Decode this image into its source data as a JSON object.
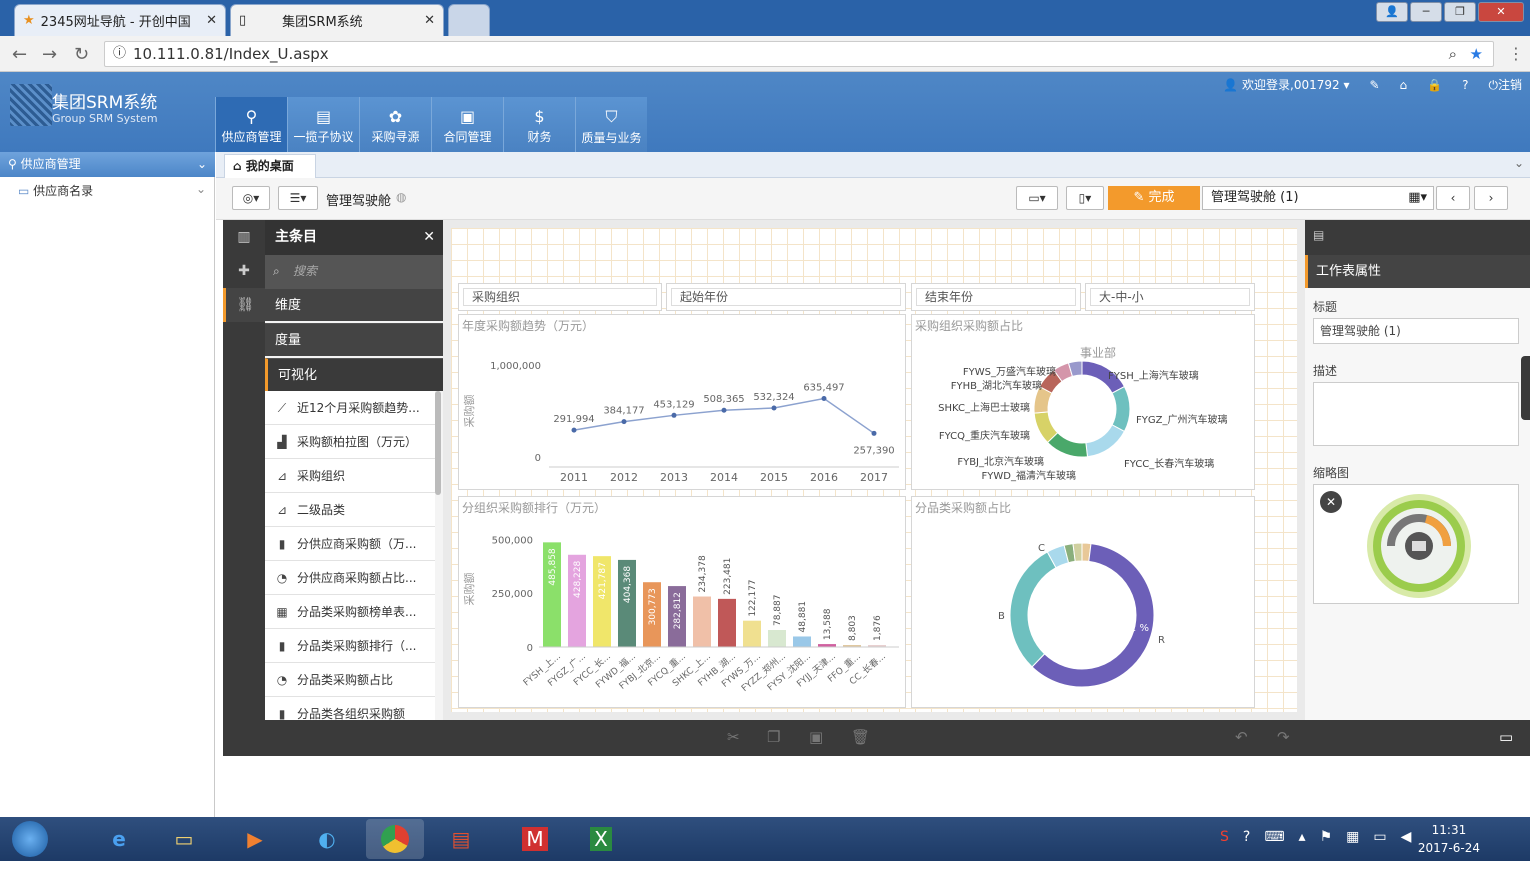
{
  "browser": {
    "tabs": [
      {
        "label": "2345网址导航 - 开创中国"
      },
      {
        "label": "集团SRM系统"
      }
    ],
    "url": "10.111.0.81/Index_U.aspx"
  },
  "app": {
    "title": "集团SRM系统",
    "subtitle": "Group SRM System",
    "modules": [
      {
        "label": "供应商管理"
      },
      {
        "label": "一揽子协议"
      },
      {
        "label": "采购寻源"
      },
      {
        "label": "合同管理"
      },
      {
        "label": "财务"
      },
      {
        "label": "质量与业务"
      }
    ],
    "user": {
      "welcome": "欢迎登录,001792",
      "logout": "注销"
    }
  },
  "sidebar": {
    "header": "供应商管理",
    "items": [
      {
        "label": "供应商名录"
      }
    ]
  },
  "content_tab": {
    "label": "我的桌面"
  },
  "toolbar": {
    "app_name": "管理驾驶舱",
    "done_label": "完成",
    "sheet_name": "管理驾驶舱 (1)"
  },
  "assets": {
    "title": "主条目",
    "search_placeholder": "搜索",
    "categories": [
      {
        "label": "维度"
      },
      {
        "label": "度量"
      },
      {
        "label": "可视化"
      }
    ],
    "items": [
      {
        "label": "近12个月采购额趋势..."
      },
      {
        "label": "采购额柏拉图（万元）"
      },
      {
        "label": "采购组织"
      },
      {
        "label": "二级品类"
      },
      {
        "label": "分供应商采购额（万..."
      },
      {
        "label": "分供应商采购额占比..."
      },
      {
        "label": "分品类采购额榜单表..."
      },
      {
        "label": "分品类采购额排行（..."
      },
      {
        "label": "分品类采购额占比"
      },
      {
        "label": "分品类各组织采购额"
      }
    ]
  },
  "filters": [
    {
      "label": "采购组织"
    },
    {
      "label": "起始年份"
    },
    {
      "label": "结束年份"
    },
    {
      "label": "大-中-小"
    }
  ],
  "chart_data": [
    {
      "type": "line",
      "title": "年度采购额趋势（万元）",
      "ylabel": "采购额",
      "x": [
        "2011",
        "2012",
        "2013",
        "2014",
        "2015",
        "2016",
        "2017"
      ],
      "values": [
        291994,
        384177,
        453129,
        508365,
        532324,
        635497,
        257390
      ],
      "labels": [
        "291,994",
        "384,177",
        "453,129",
        "508,365",
        "532,324",
        "635,497",
        "257,390"
      ],
      "yticks": [
        "1,000,000",
        "0"
      ],
      "ylim": [
        0,
        1000000
      ]
    },
    {
      "type": "pie",
      "title": "采购组织采购额占比",
      "legend_title": "事业部",
      "categories": [
        "FYSH_上海汽车玻璃",
        "FYGZ_广州汽车玻璃",
        "FYCC_长春汽车玻璃",
        "FYWD_福清汽车玻璃",
        "FYBJ_北京汽车玻璃",
        "FYCQ_重庆汽车玻璃",
        "SHKC_上海巴士玻璃",
        "FYHB_湖北汽车玻璃",
        "FYWS_万盛汽车玻璃"
      ],
      "values": [
        19,
        17,
        17,
        16,
        12,
        10,
        8,
        6,
        5
      ]
    },
    {
      "type": "bar",
      "title": "分组织采购额排行（万元）",
      "ylabel": "采购额",
      "categories": [
        "FYSH_上...",
        "FYGZ_广...",
        "FYCC_长...",
        "FYWD_福...",
        "FYBJ_北京...",
        "FYCQ_重...",
        "SHKC_上...",
        "FYHB_湖...",
        "FYWS_万...",
        "FYZZ_郑州...",
        "FYSY_沈阳...",
        "FYJJ_天津...",
        "FFO_重...",
        "CC_长春..."
      ],
      "values": [
        485858,
        428228,
        421787,
        404368,
        300773,
        282812,
        234378,
        223481,
        122177,
        78887,
        48881,
        13588,
        8803,
        1876
      ],
      "labels": [
        "485,858",
        "428,228",
        "421,787",
        "404,368",
        "300,773",
        "282,812",
        "234,378",
        "223,481",
        "122,177",
        "78,887",
        "48,881",
        "13,588",
        "8,803",
        "1,876"
      ],
      "yticks": [
        "500,000",
        "250,000",
        "0"
      ],
      "ylim": [
        0,
        520000
      ]
    },
    {
      "type": "pie",
      "title": "分品类采购额占比",
      "categories": [
        "R",
        "B",
        "C"
      ],
      "values": [
        60.2,
        29.8,
        10.0
      ],
      "labels": [
        "60.2 %",
        "29.8 %"
      ]
    }
  ],
  "properties": {
    "header": "工作表属性",
    "title_label": "标题",
    "title_value": "管理驾驶舱 (1)",
    "desc_label": "描述",
    "thumb_label": "缩略图"
  },
  "taskbar": {
    "time": "11:31",
    "date": "2017-6-24"
  },
  "colors": {
    "app_blue": "#4a82c2",
    "accent_orange": "#f39a2c",
    "line_series": "#8ca2cf",
    "pie_org": [
      "#6c5fb8",
      "#6ec0bf",
      "#a9d9ec",
      "#4aa86a",
      "#d7d267",
      "#e5c58a",
      "#b8655b",
      "#d495aa",
      "#9999cc"
    ],
    "bars": [
      "#8be06a",
      "#e4a4df",
      "#f0e66a",
      "#5a8a78",
      "#e8965a",
      "#8a6c9a",
      "#f0c0a8",
      "#c05858",
      "#f0e090",
      "#d8e8d0",
      "#9ac8e8",
      "#d060a0",
      "#e0c8a0",
      "#e8d0d0"
    ],
    "pie_cat": [
      "#6c5fb8",
      "#6ec0bf",
      "#a9d9ec"
    ]
  }
}
